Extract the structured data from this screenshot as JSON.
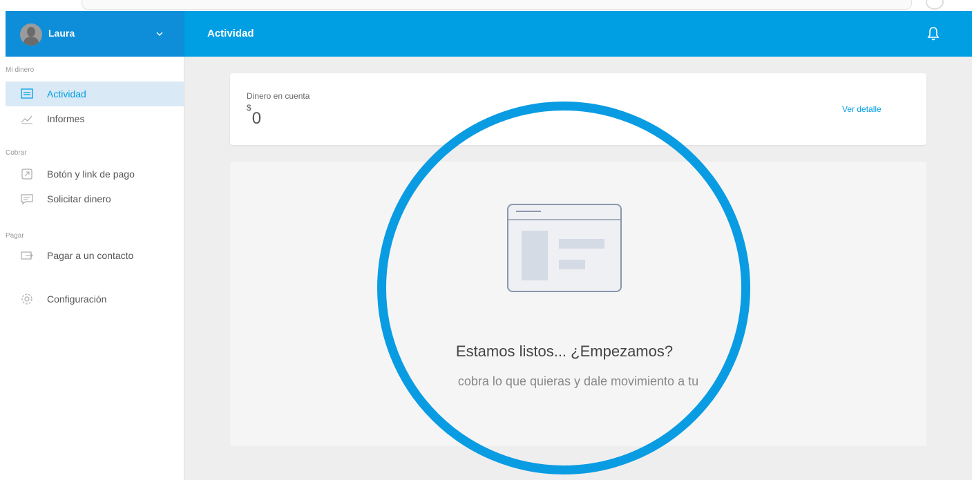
{
  "user": {
    "name": "Laura"
  },
  "header": {
    "title": "Actividad"
  },
  "sidebar": {
    "sections": [
      {
        "label": "Mi dinero"
      },
      {
        "label": "Cobrar"
      },
      {
        "label": "Pagar"
      }
    ],
    "items": [
      {
        "label": "Actividad",
        "icon": "list-icon",
        "active": true
      },
      {
        "label": "Informes",
        "icon": "chart-icon",
        "active": false
      },
      {
        "label": "Botón y link de pago",
        "icon": "link-icon",
        "active": false
      },
      {
        "label": "Solicitar dinero",
        "icon": "message-icon",
        "active": false
      },
      {
        "label": "Pagar a un contacto",
        "icon": "transfer-icon",
        "active": false
      },
      {
        "label": "Configuración",
        "icon": "gear-icon",
        "active": false
      }
    ]
  },
  "balance": {
    "label": "Dinero en cuenta",
    "currency": "$",
    "amount": "0",
    "link": "Ver detalle"
  },
  "empty_state": {
    "title": "Estamos listos... ¿Empezamos?",
    "subtitle": "cobra lo que quieras y dale movimiento a tu"
  },
  "colors": {
    "header": "#009ee3",
    "user_bar": "#0e8ed8",
    "highlight_ring": "#0a9ce2",
    "active_item_bg": "#d9e9f5"
  }
}
